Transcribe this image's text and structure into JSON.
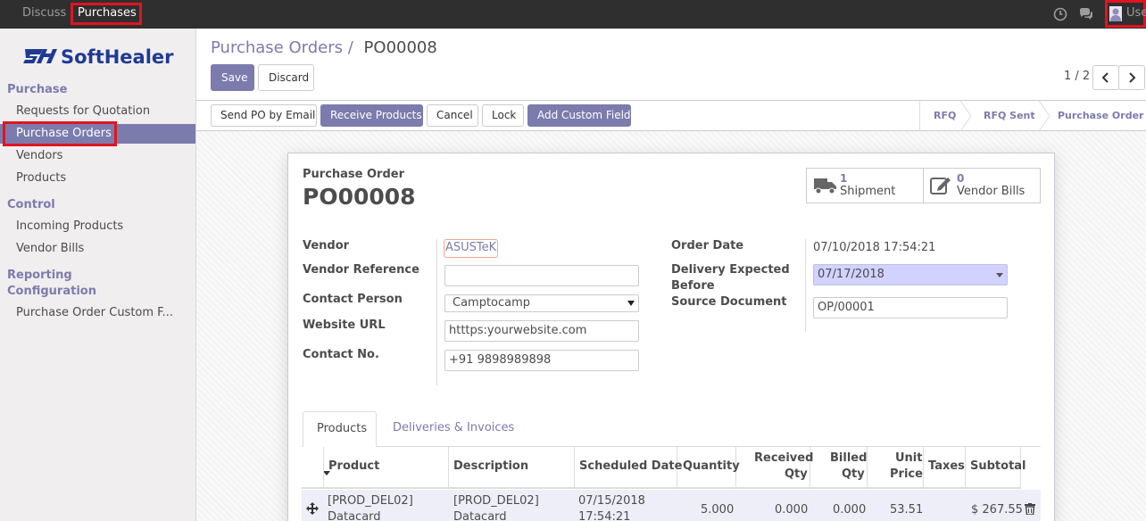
{
  "topbar": {
    "apps": [
      {
        "label": "Discuss",
        "active": false
      },
      {
        "label": "Purchases",
        "active": true
      }
    ],
    "user_label": "Use"
  },
  "sidebar": {
    "logo_text": "SoftHealer",
    "sections": [
      {
        "title": "Purchase",
        "items": [
          "Requests for Quotation",
          "Purchase Orders",
          "Vendors",
          "Products"
        ]
      },
      {
        "title": "Control",
        "items": [
          "Incoming Products",
          "Vendor Bills"
        ]
      },
      {
        "title": "Reporting",
        "items": []
      },
      {
        "title": "Configuration",
        "items": [
          "Purchase Order Custom F..."
        ]
      }
    ],
    "active_item": "Purchase Orders"
  },
  "control_panel": {
    "breadcrumb_parent": "Purchase Orders",
    "breadcrumb_sep": "/",
    "breadcrumb_current": "PO00008",
    "save_label": "Save",
    "discard_label": "Discard",
    "pager": "1 / 2"
  },
  "statusbar": {
    "buttons": [
      "Send PO by Email",
      "Receive Products",
      "Cancel",
      "Lock",
      "Add Custom Field"
    ],
    "stages": [
      "RFQ",
      "RFQ Sent",
      "Purchase Order"
    ],
    "current_stage": "Purchase Order"
  },
  "form": {
    "doc_type": "Purchase Order",
    "name": "PO00008",
    "smart_buttons": [
      {
        "count": "1",
        "label": "Shipment",
        "icon": "truck-icon"
      },
      {
        "count": "0",
        "label": "Vendor Bills",
        "icon": "edit-icon"
      }
    ],
    "left": {
      "vendor_label": "Vendor",
      "vendor_value": "ASUSTeK",
      "vendor_ref_label": "Vendor Reference",
      "vendor_ref_value": "",
      "contact_label": "Contact Person",
      "contact_value": "Camptocamp",
      "website_label": "Website URL",
      "website_value": "htttps:yourwebsite.com",
      "contact_no_label": "Contact No.",
      "contact_no_value": "+91 9898989898"
    },
    "right": {
      "order_date_label": "Order Date",
      "order_date_value": "07/10/2018 17:54:21",
      "delivery_label_1": "Delivery Expected",
      "delivery_label_2": "Before",
      "delivery_value": "07/17/2018",
      "source_label": "Source Document",
      "source_value": "OP/00001"
    },
    "tabs": [
      "Products",
      "Deliveries & Invoices"
    ],
    "active_tab": "Products"
  },
  "lines": {
    "headers": {
      "product": "Product",
      "description": "Description",
      "scheduled": "Scheduled Date",
      "quantity": "Quantity",
      "received_1": "Received",
      "received_2": "Qty",
      "billed_1": "Billed",
      "billed_2": "Qty",
      "unit_1": "Unit",
      "unit_2": "Price",
      "taxes": "Taxes",
      "subtotal": "Subtotal"
    },
    "rows": [
      {
        "product_1": "[PROD_DEL02]",
        "product_2": "Datacard",
        "description_1": "[PROD_DEL02]",
        "description_2": "Datacard",
        "scheduled_1": "07/15/2018",
        "scheduled_2": "17:54:21",
        "quantity": "5.000",
        "received": "0.000",
        "billed": "0.000",
        "unit_price": "53.51",
        "taxes": "",
        "subtotal": "$ 267.55"
      }
    ]
  },
  "colors": {
    "brand": "#7c7bad",
    "topbar": "#2f2f2f",
    "highlight": "#e0151f"
  }
}
